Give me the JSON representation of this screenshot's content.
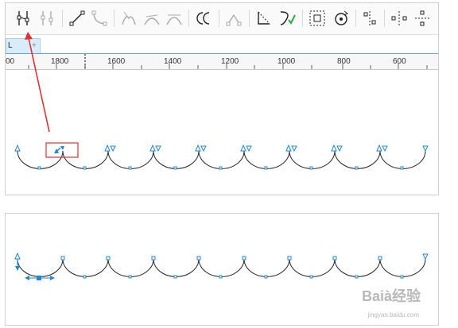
{
  "toolbar": {
    "tools": [
      {
        "icon": "add-node-icon"
      },
      {
        "icon": "delete-node-icon"
      },
      {
        "icon": "to-line-icon"
      },
      {
        "icon": "to-curve-icon"
      },
      {
        "icon": "cusp-node-icon"
      },
      {
        "icon": "smooth-node-icon"
      },
      {
        "icon": "symmetrical-node-icon"
      },
      {
        "icon": "reverse-direction-icon"
      },
      {
        "icon": "extend-curve-icon"
      },
      {
        "icon": "close-curve-icon"
      },
      {
        "icon": "auto-close-icon"
      },
      {
        "icon": "stretch-nodes-icon"
      },
      {
        "icon": "rotate-nodes-icon"
      },
      {
        "icon": "align-nodes-icon"
      },
      {
        "icon": "mirror-horizontal-icon"
      },
      {
        "icon": "mirror-vertical-icon"
      }
    ]
  },
  "page_tab": {
    "label": "L",
    "plus": "+"
  },
  "ruler": {
    "labels": [
      "00",
      "1800",
      "1600",
      "1400",
      "1200",
      "1000",
      "800",
      "600"
    ]
  },
  "watermark": {
    "brand": "Baià经验",
    "url": "jingyan.baidu.com"
  },
  "colors": {
    "accent": "#e03030",
    "node": "#1e88d6",
    "curve": "#222222"
  }
}
